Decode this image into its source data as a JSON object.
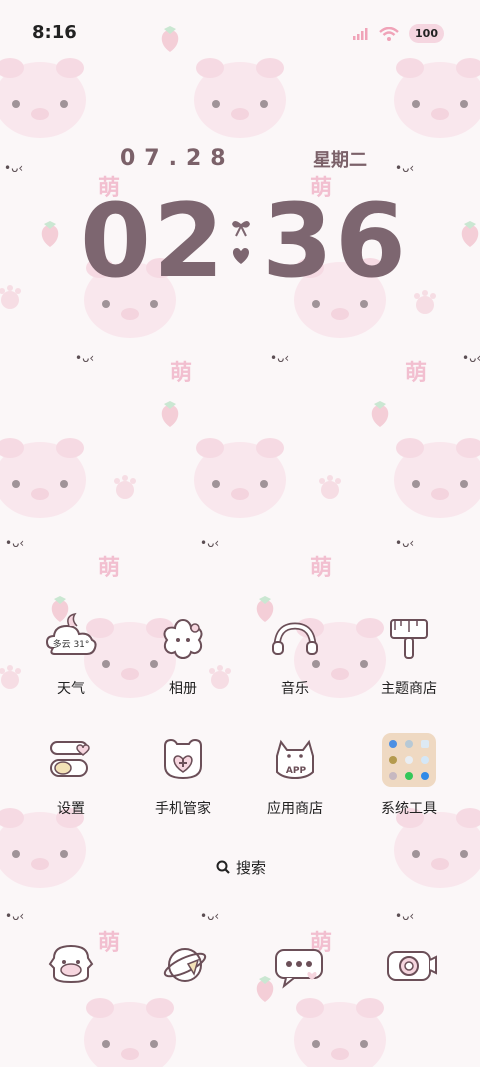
{
  "status_bar": {
    "time": "8:16",
    "battery": "100",
    "icons": [
      "signal-icon",
      "wifi-icon",
      "battery-icon"
    ]
  },
  "lockscreen": {
    "date": "07.28",
    "weekday": "星期二",
    "hours": "02",
    "minutes": "36"
  },
  "apps": [
    {
      "label": "天气",
      "icon": "weather-icon",
      "weather_text": "多云 31°"
    },
    {
      "label": "相册",
      "icon": "gallery-icon"
    },
    {
      "label": "音乐",
      "icon": "music-icon"
    },
    {
      "label": "主题商店",
      "icon": "theme-store-icon"
    },
    {
      "label": "设置",
      "icon": "settings-icon"
    },
    {
      "label": "手机管家",
      "icon": "phone-manager-icon"
    },
    {
      "label": "应用商店",
      "icon": "app-store-icon",
      "badge_text": "APP"
    },
    {
      "label": "系统工具",
      "icon": "system-tools-folder-icon"
    }
  ],
  "search": {
    "label": "搜索",
    "icon": "search-icon"
  },
  "dock": [
    {
      "icon": "phone-icon"
    },
    {
      "icon": "browser-icon"
    },
    {
      "icon": "messages-icon"
    },
    {
      "icon": "camera-icon"
    }
  ],
  "colors": {
    "clock": "#7d6670",
    "accent_pink": "#f2c4d2",
    "outline": "#6b4f58"
  }
}
